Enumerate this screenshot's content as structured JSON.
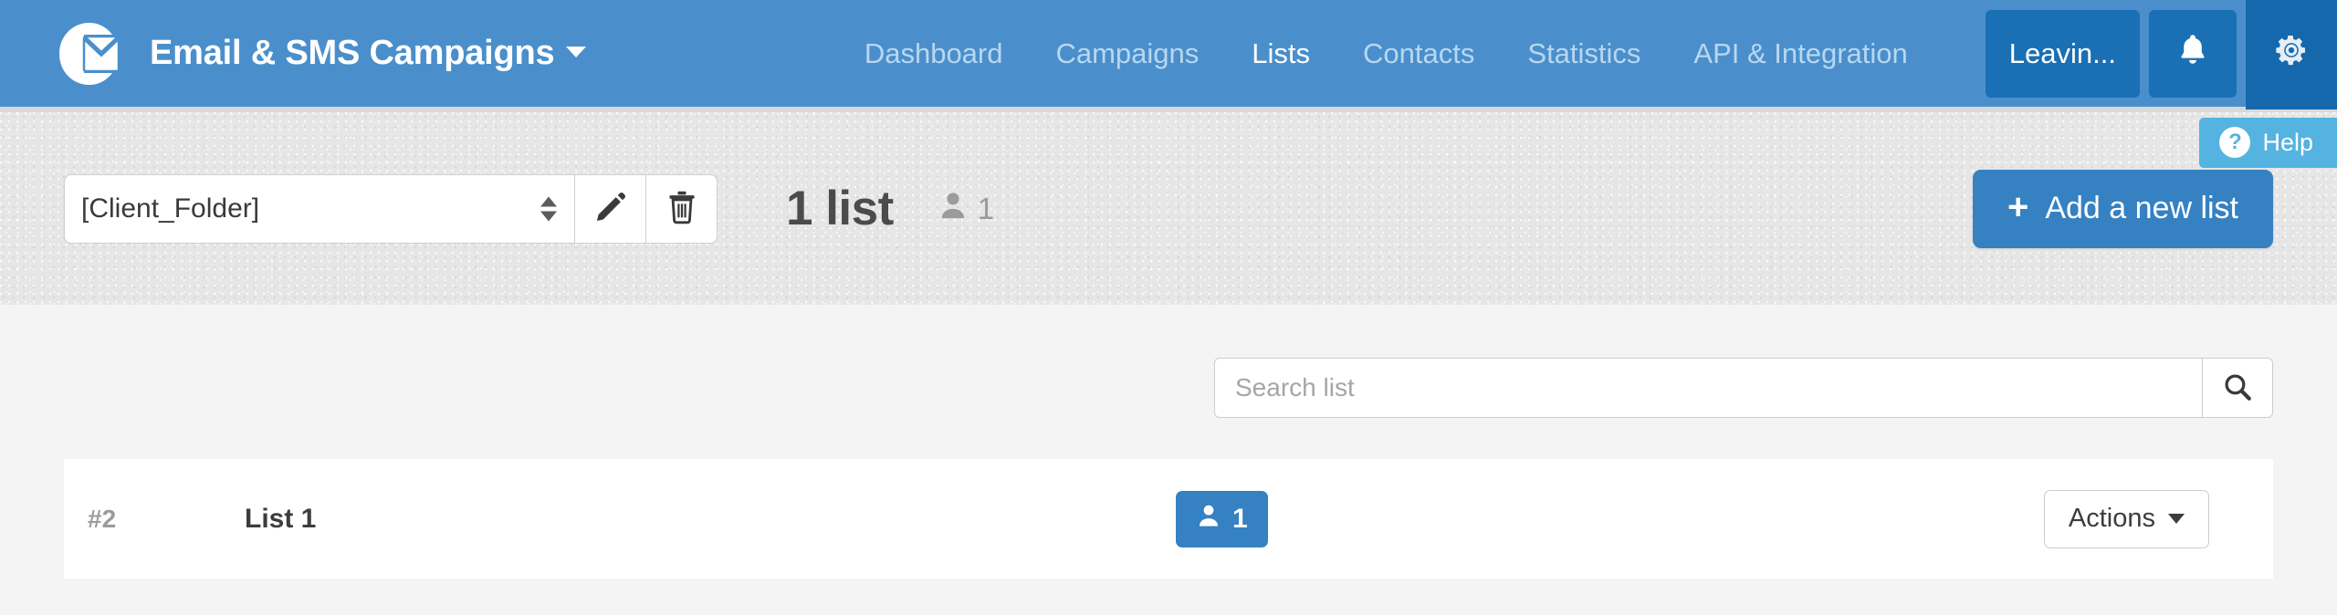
{
  "header": {
    "logo_icon": "envelope-circle-logo",
    "brand_title": "Email & SMS Campaigns",
    "brand_caret_icon": "chevron-down-icon",
    "nav_links": [
      {
        "label": "Dashboard",
        "active": false
      },
      {
        "label": "Campaigns",
        "active": false
      },
      {
        "label": "Lists",
        "active": true
      },
      {
        "label": "Contacts",
        "active": false
      },
      {
        "label": "Statistics",
        "active": false
      },
      {
        "label": "API & Integration",
        "active": false
      }
    ],
    "leaving_button_label": "Leavin...",
    "bell_icon": "bell-icon",
    "gear_icon": "gear-icon",
    "bg_color": "#4a8fcc",
    "button_color": "#1a6fb5"
  },
  "help_tab": {
    "label": "Help",
    "icon": "question-mark-circle-icon",
    "bg_color": "#54b3e0",
    "question_glyph": "?"
  },
  "subheader": {
    "folder_select_value": "[Client_Folder]",
    "folder_spinner_icon": "spinner-up-down-icon",
    "edit_icon": "pencil-icon",
    "delete_icon": "trash-icon",
    "count_title": "1 list",
    "contacts_icon": "person-icon",
    "contacts_count": "1",
    "add_button_label": "Add a new list",
    "add_button_plus": "+",
    "add_button_color": "#3581c2"
  },
  "search": {
    "placeholder": "Search list",
    "value": "",
    "search_icon": "magnifier-icon"
  },
  "table": {
    "rows": [
      {
        "rank": "#2",
        "name": "List 1",
        "subscribers_icon": "person-icon",
        "subscribers": "1",
        "actions_label": "Actions",
        "actions_caret_icon": "caret-down-icon"
      }
    ]
  }
}
